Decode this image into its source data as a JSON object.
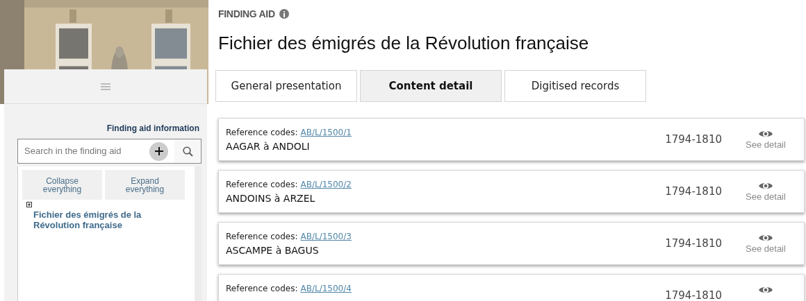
{
  "sidebar": {
    "info_link": "Finding aid information",
    "search": {
      "placeholder": "Search in the finding aid"
    },
    "buttons": [
      "Collapse everything",
      "Expand everything"
    ],
    "tree": [
      {
        "label": "Fichier des émigrés de la Révolution française",
        "expanded": false
      }
    ]
  },
  "header": {
    "kicker": "FINDING AID",
    "title": "Fichier des émigrés de la Révolution française"
  },
  "tabs": [
    {
      "label": "General presentation",
      "selected": false
    },
    {
      "label": "Content detail",
      "selected": true
    },
    {
      "label": "Digitised records",
      "selected": false
    }
  ],
  "records": [
    {
      "ref_label": "Reference codes:",
      "ref": "AB/L/1500/1",
      "title": "AAGAR à ANDOLI",
      "dates": "1794-1810",
      "action": "See detail"
    },
    {
      "ref_label": "Reference codes:",
      "ref": "AB/L/1500/2",
      "title": "ANDOINS à ARZEL",
      "dates": "1794-1810",
      "action": "See detail"
    },
    {
      "ref_label": "Reference codes:",
      "ref": "AB/L/1500/3",
      "title": "ASCAMPE à BAGUS",
      "dates": "1794-1810",
      "action": "See detail"
    },
    {
      "ref_label": "Reference codes:",
      "ref": "AB/L/1500/4",
      "dates": "1794-1810"
    }
  ]
}
